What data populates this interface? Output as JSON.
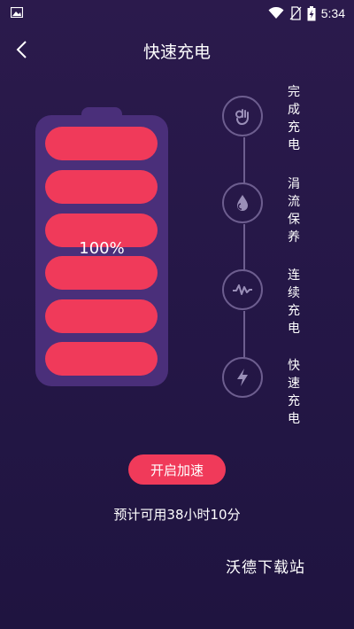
{
  "status_bar": {
    "time": "5:34",
    "icons": [
      "image-icon",
      "wifi-icon",
      "no-sim-icon",
      "battery-charging-icon"
    ]
  },
  "header": {
    "title": "快速充电",
    "back_icon": "back-arrow-icon"
  },
  "battery": {
    "percent": "100%",
    "level": 1.0,
    "cells": 6
  },
  "steps": [
    {
      "label": "完成充电",
      "icon": "ok-hand-icon"
    },
    {
      "label": "涓流保养",
      "icon": "water-drop-icon"
    },
    {
      "label": "连续充电",
      "icon": "pulse-wave-icon"
    },
    {
      "label": "快速充电",
      "icon": "lightning-bolt-icon"
    }
  ],
  "actions": {
    "boost_label": "开启加速"
  },
  "estimate_text": "预计可用38小时10分",
  "watermark": "沃德下载站",
  "colors": {
    "accent": "#f03a5a",
    "battery_shell": "#4a2f7a",
    "timeline": "#6d5e8f",
    "background": "#251747"
  }
}
